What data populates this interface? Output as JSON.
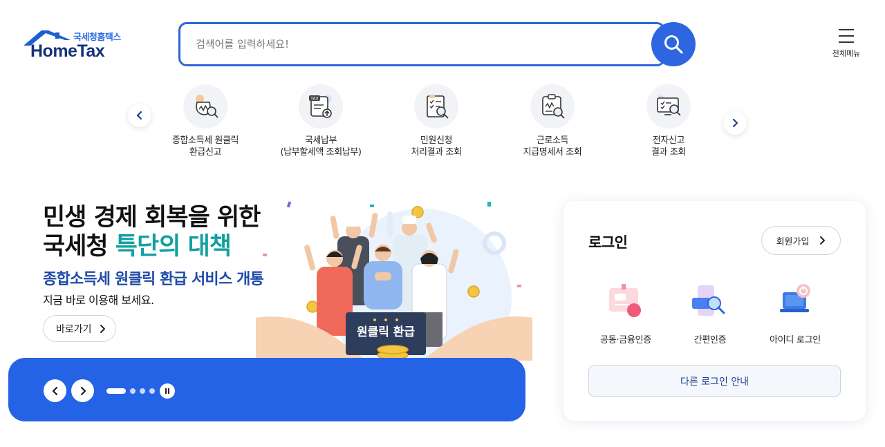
{
  "header": {
    "logo_sub": "국세청홈택스",
    "logo_main": "HomeTax",
    "search_placeholder": "검색어를 입력하세요!",
    "menu_label": "전체메뉴"
  },
  "quick_menu": {
    "items": [
      {
        "line1": "종합소득세 원클릭",
        "line2": "환급신고",
        "icon": "tax-refund-icon"
      },
      {
        "line1": "국세납부",
        "line2": "(납부할세액 조회납부)",
        "icon": "tax-payment-icon"
      },
      {
        "line1": "민원신청",
        "line2": "처리결과 조회",
        "icon": "civil-request-icon"
      },
      {
        "line1": "근로소득",
        "line2": "지급명세서 조회",
        "icon": "income-statement-icon"
      },
      {
        "line1": "전자신고",
        "line2": "결과 조회",
        "icon": "e-filing-result-icon"
      }
    ]
  },
  "banner": {
    "title_line1": "민생 경제 회복을 위한",
    "title_line2_plain": "국세청 ",
    "title_line2_highlight": "특단의 대책",
    "subtitle": "종합소득세 원클릭 환급 서비스 개통",
    "description": "지금 바로 이용해 보세요.",
    "go_button": "바로가기",
    "sign_text": "원클릭 환급",
    "slide_count": 4,
    "active_slide": 1
  },
  "login": {
    "title": "로그인",
    "join_button": "회원가입",
    "options": [
      {
        "label": "공동·금융인증",
        "icon": "certificate-icon"
      },
      {
        "label": "간편인증",
        "icon": "simple-auth-icon"
      },
      {
        "label": "아이디 로그인",
        "icon": "id-login-icon"
      }
    ],
    "other_button": "다른 로그인 안내"
  },
  "colors": {
    "primary": "#2563e6",
    "search_border": "#2f63d9",
    "title_highlight": "#11a0a0",
    "subtitle": "#1f4aa8",
    "logo_dark": "#14327a"
  }
}
